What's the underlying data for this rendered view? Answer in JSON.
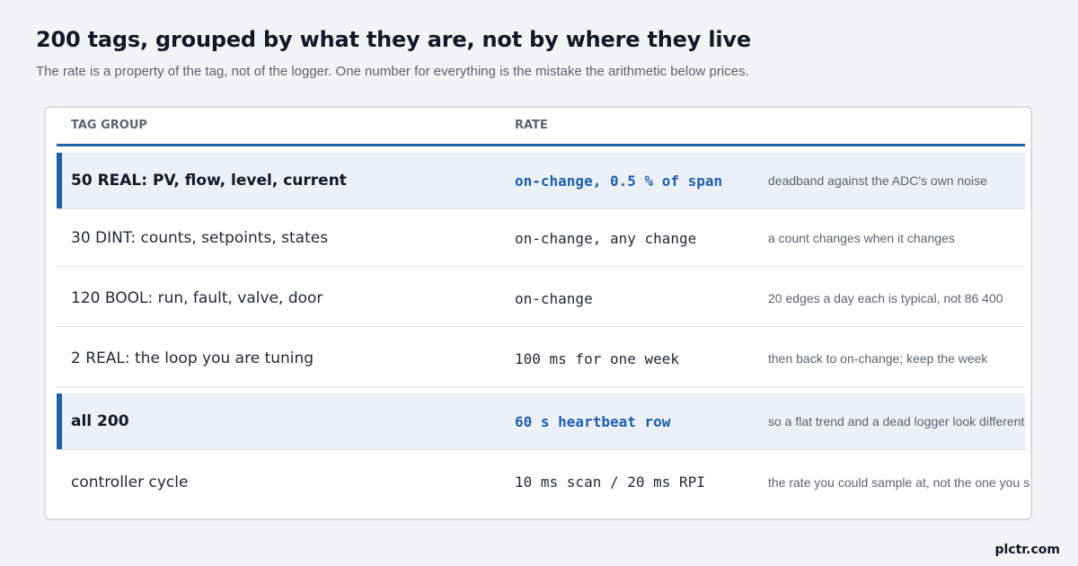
{
  "title": "200 tags, grouped by what they are, not by where they live",
  "subtitle": "The rate is a property of the tag, not of the logger. One number for everything is the mistake the arithmetic below prices.",
  "table": {
    "headers": {
      "group": "TAG GROUP",
      "rate": "RATE"
    },
    "rows": [
      {
        "group": "50 REAL: PV, flow, level, current",
        "rate": "on-change, 0.5 % of span",
        "note": "deadband against the ADC's own noise",
        "highlight": true
      },
      {
        "group": "30 DINT: counts, setpoints, states",
        "rate": "on-change, any change",
        "note": "a count changes when it changes",
        "highlight": false
      },
      {
        "group": "120 BOOL: run, fault, valve, door",
        "rate": "on-change",
        "note": "20 edges a day each is typical, not 86 400",
        "highlight": false
      },
      {
        "group": "2 REAL: the loop you are tuning",
        "rate": "100 ms for one week",
        "note": "then back to on-change; keep the week",
        "highlight": false
      },
      {
        "group": "all 200",
        "rate": "60 s heartbeat row",
        "note": "so a flat trend and a dead logger look different",
        "highlight": true
      },
      {
        "group": "controller cycle",
        "rate": "10 ms scan / 20 ms RPI",
        "note": "the rate you could sample at, not the one you should",
        "highlight": false
      }
    ]
  },
  "colors": {
    "accent": "#1f5fae",
    "highlight_bg": "#ecf1f8"
  },
  "brand": "plctr.com"
}
